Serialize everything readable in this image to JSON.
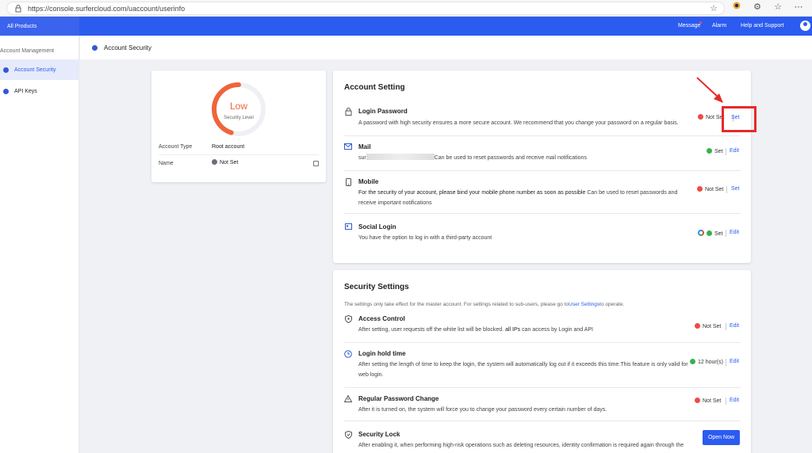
{
  "browser": {
    "url": "https://console.surfercloud.com/uaccount/userinfo"
  },
  "topnav": {
    "all_products": "All Products",
    "message": "Message",
    "alarm": "Alarm",
    "help": "Help and Support"
  },
  "sidebar": {
    "group": "Account Management",
    "items": [
      {
        "label": "Account Security"
      },
      {
        "label": "API Keys"
      }
    ]
  },
  "page": {
    "title": "Account Security"
  },
  "level": {
    "value": "Low",
    "label": "Security Level",
    "score_fraction": 0.45,
    "accent": "#f0643a",
    "account_type_label": "Account Type",
    "account_type_value": "Root account",
    "name_label": "Name",
    "name_value": "Not Set"
  },
  "account_setting": {
    "title": "Account Setting",
    "rows": [
      {
        "icon": "lock-icon",
        "title": "Login Password",
        "desc": "A password with high security ensures a more secure account. We recommend that you change your password on a regular basis.",
        "status": "Not Set",
        "action": "Set"
      },
      {
        "icon": "mail-icon",
        "title": "Mail",
        "desc_prefix": "sur",
        "desc": "Can be used to reset passwords and receive mail notifications",
        "status": "Set",
        "action": "Edit"
      },
      {
        "icon": "mobile-icon",
        "title": "Mobile",
        "desc_bold": "For the security of your account, please bind your mobile phone number as soon as possible",
        "desc": " Can be used to reset passwords and receive important notifications",
        "status": "Not Set",
        "action": "Set"
      },
      {
        "icon": "social-login-icon",
        "title": "Social Login",
        "desc": "You have the option to log in with a third-party account",
        "status": "Set",
        "action": "Edit"
      }
    ]
  },
  "security_settings": {
    "title": "Security Settings",
    "note_prefix": "The settings only take effect for the master account. For settings related to sub-users, please go to",
    "note_link": "User Settings",
    "note_suffix": "to operate.",
    "rows": [
      {
        "icon": "shield-icon",
        "title": "Access Control",
        "desc_prefix": "After setting, user requests off the white list will be blocked.",
        "desc_bold": " all IPs",
        "desc": " can access by Login and API",
        "status": "Not Set",
        "action": "Edit"
      },
      {
        "icon": "clock-icon",
        "title": "Login hold time",
        "desc": "After setting the length of time to keep the login, the system will automatically log out if it exceeds this time.This feature is only valid for web login.",
        "status": "12 hour(s)",
        "action": "Edit"
      },
      {
        "icon": "warning-icon",
        "title": "Regular Password Change",
        "desc": "After it is turned on, the system will force you to change your password every certain number of days.",
        "status": "Not Set",
        "action": "Edit"
      },
      {
        "icon": "shield-check-icon",
        "title": "Security Lock",
        "desc": "After enabling it, when performing high-risk operations such as deleting resources, identity confirmation is required again through the",
        "action": "Open Now"
      }
    ]
  },
  "colors": {
    "brand": "#2c5bf0",
    "danger": "#f04a44",
    "success": "#37b24d",
    "highlight": "#e52a2a"
  }
}
